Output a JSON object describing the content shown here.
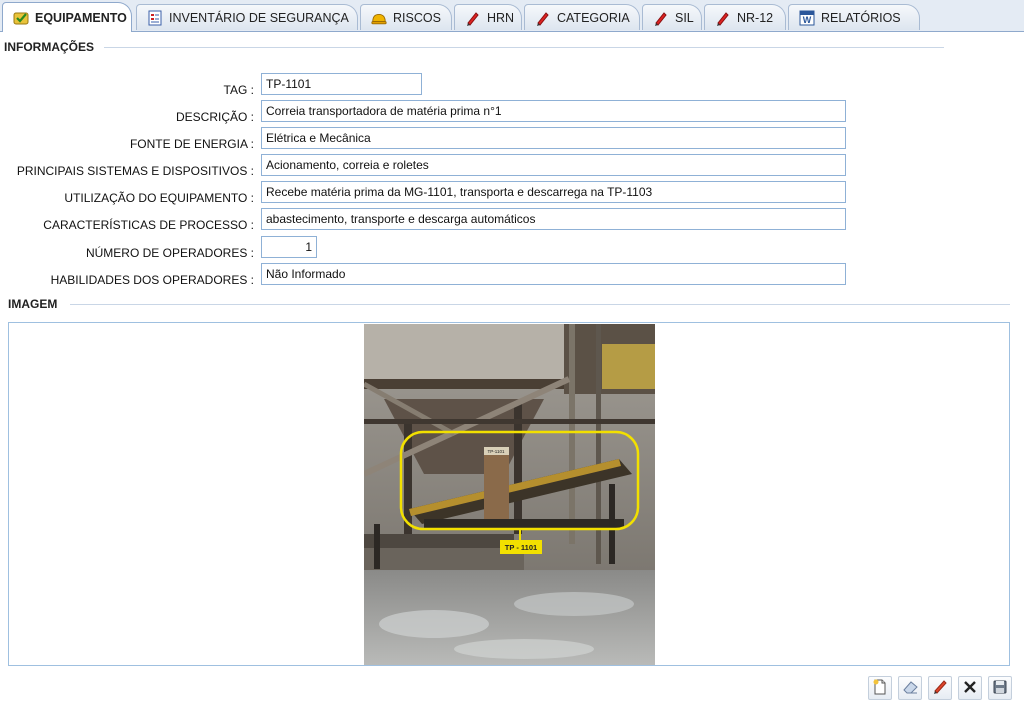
{
  "tabs": [
    {
      "label": "EQUIPAMENTO",
      "icon": "equipment-check-icon",
      "active": true
    },
    {
      "label": "INVENTÁRIO DE SEGURANÇA",
      "icon": "inventory-list-icon"
    },
    {
      "label": "RISCOS",
      "icon": "hard-hat-icon"
    },
    {
      "label": "HRN",
      "icon": "pen-icon"
    },
    {
      "label": "CATEGORIA",
      "icon": "pen-icon"
    },
    {
      "label": "SIL",
      "icon": "pen-icon"
    },
    {
      "label": "NR-12",
      "icon": "pen-icon"
    },
    {
      "label": "RELATÓRIOS",
      "icon": "word-document-icon"
    }
  ],
  "info": {
    "title": "INFORMAÇÕES",
    "fields": [
      {
        "label": "TAG :",
        "value": "TP-1101"
      },
      {
        "label": "DESCRIÇÃO :",
        "value": "Correia transportadora de matéria prima n°1"
      },
      {
        "label": "FONTE DE ENERGIA :",
        "value": "Elétrica e Mecânica"
      },
      {
        "label": "PRINCIPAIS SISTEMAS E DISPOSITIVOS :",
        "value": "Acionamento, correia e roletes"
      },
      {
        "label": "UTILIZAÇÃO DO EQUIPAMENTO :",
        "value": "Recebe matéria prima da MG-1101, transporta  e descarrega na TP-1103"
      },
      {
        "label": "CARACTERÍSTICAS DE PROCESSO :",
        "value": "abastecimento, transporte e descarga automáticos"
      },
      {
        "label": "NÚMERO DE OPERADORES :",
        "value": "1"
      },
      {
        "label": "HABILIDADES DOS OPERADORES :",
        "value": "Não Informado"
      }
    ]
  },
  "image": {
    "title": "IMAGEM",
    "callout_label": "TP - 1101",
    "sign_label": "TP-1101"
  },
  "toolbar": [
    "new-document-icon",
    "eraser-icon",
    "edit-pencil-icon",
    "delete-x-icon",
    "save-disk-icon"
  ],
  "colors": {
    "accent_border": "#8fb1d6",
    "highlight": "#f2e000"
  }
}
